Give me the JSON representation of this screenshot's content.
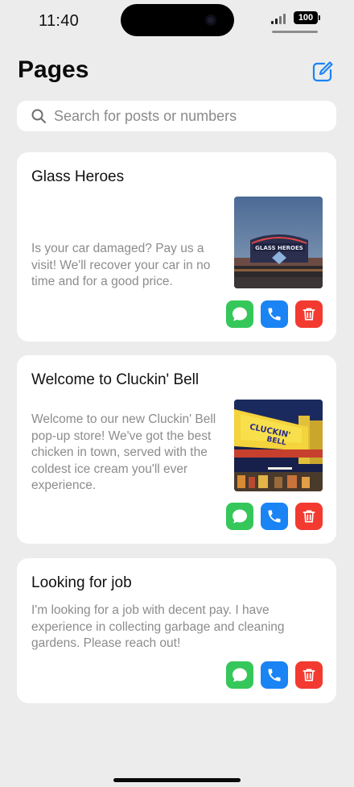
{
  "status_bar": {
    "time": "11:40",
    "battery": "100"
  },
  "header": {
    "title": "Pages",
    "compose_icon": "compose-icon"
  },
  "search": {
    "placeholder": "Search for posts or numbers",
    "value": "",
    "icon": "search-icon"
  },
  "posts": [
    {
      "title": "Glass Heroes",
      "description": "Is your car damaged? Pay us a visit! We'll recover your car in no time and for a good price.",
      "has_image": true,
      "image_subject": "Glass Heroes shop sign"
    },
    {
      "title": "Welcome to Cluckin' Bell",
      "description": "Welcome to our new Cluckin' Bell pop-up store! We've got the best chicken in town, served with the coldest ice cream you'll ever experience.",
      "has_image": true,
      "image_subject": "Cluckin' Bell storefront"
    },
    {
      "title": "Looking for job",
      "description": "I'm looking for a job with decent pay. I have experience in collecting garbage and cleaning gardens. Please reach out!",
      "has_image": false
    }
  ],
  "actions": {
    "message_icon": "message-icon",
    "call_icon": "phone-icon",
    "delete_icon": "trash-icon"
  },
  "colors": {
    "background": "#ececec",
    "message": "#35c759",
    "call": "#1a84f5",
    "delete": "#f33a30",
    "accent": "#1a84f5"
  }
}
